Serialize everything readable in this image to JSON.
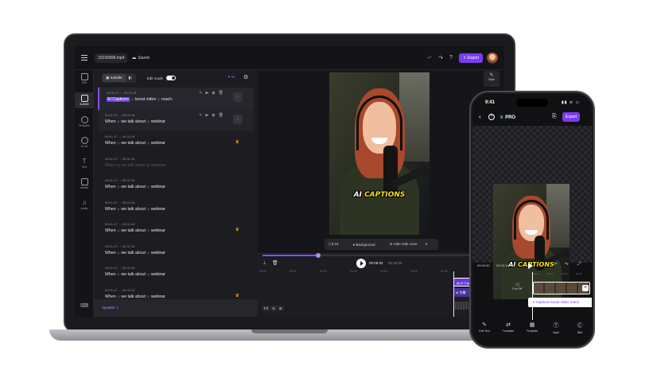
{
  "laptop": {
    "topbar": {
      "file_name": "20230908.mp4",
      "saved_label": "Saved",
      "undo_icon": "undo-icon",
      "redo_icon": "redo-icon",
      "help_icon": "help-icon",
      "export_label": "Export"
    },
    "left_rail": [
      {
        "label": "Edit",
        "icon": "edit-icon"
      },
      {
        "label": "Subtitle",
        "icon": "subtitle-icon",
        "active": true
      },
      {
        "label": "Template",
        "icon": "template-icon"
      },
      {
        "label": "B-roll",
        "icon": "broll-icon"
      },
      {
        "label": "Text",
        "icon": "text-icon"
      },
      {
        "label": "Media",
        "icon": "media-icon"
      },
      {
        "label": "Audio",
        "icon": "audio-icon"
      }
    ],
    "panel": {
      "tabs": [
        "Subtitle",
        ""
      ],
      "edit_mode_label": "Edit mode",
      "ai_label": "AI",
      "speaker_label": "Speaker 1"
    },
    "subtitles": [
      {
        "time": "00:01.47 → 00:02.18",
        "highlight": "AI Captions",
        "rest": "boost video",
        "tail": "reach."
      },
      {
        "time": "00:01.47 → 00:02.18",
        "highlight": "",
        "rest": "When",
        "mid": "we talk about",
        "tail": "webinar"
      },
      {
        "time": "00:01.47 → 00:02.18",
        "highlight": "",
        "rest": "When",
        "mid": "we talk about",
        "tail": "webinar"
      },
      {
        "time": "00:01.47 → 00:02.18",
        "highlight": "",
        "rest": "When",
        "mid": "we talk about",
        "tail": "webinar"
      },
      {
        "time": "00:01.47 → 00:02.18",
        "highlight": "",
        "rest": "When",
        "mid": "we talk about",
        "tail": "webinar"
      },
      {
        "time": "00:01.47 → 00:02.18",
        "highlight": "",
        "rest": "When",
        "mid": "we talk about",
        "tail": "webinar"
      },
      {
        "time": "00:01.47 → 00:02.18",
        "highlight": "",
        "rest": "When",
        "mid": "we talk about",
        "tail": "webinar"
      },
      {
        "time": "00:01.47 → 00:02.18",
        "highlight": "",
        "rest": "When",
        "mid": "we talk about",
        "tail": "webinar"
      },
      {
        "time": "00:01.47 → 00:02.18",
        "highlight": "",
        "rest": "When",
        "mid": "we talk about",
        "tail": "webinar"
      },
      {
        "time": "00:01.47 → 00:02.18",
        "highlight": "",
        "rest": "When",
        "mid": "we talk about",
        "tail": "webinar"
      }
    ],
    "preview": {
      "style_label": "Style",
      "caption_part1": "AI",
      "caption_part2": "CAPTIONS",
      "ratio": "9:16",
      "background_label": "Background",
      "safe_zone_label": "Hide safe zone"
    },
    "timeline": {
      "progress": 0.26,
      "current_time": "00:08.02",
      "total_time": "02:34.02",
      "ruler": [
        "00:00",
        "00:01",
        "00:02",
        "00:03",
        "00:04",
        "00:05",
        "00:06",
        "00:07"
      ],
      "clips_row1": [
        "AI Capti...",
        "boost",
        "video"
      ],
      "clips_row2": [
        "字幕",
        "提升",
        "视频"
      ],
      "fit_label": "Fit"
    }
  },
  "phone": {
    "time": "9:41",
    "pro_label": "PRO",
    "export_label": "Export",
    "caption_part1": "AI",
    "caption_part2": "CAPTIONS",
    "current_time": "00:00:00",
    "total_time": "00:00:10",
    "ruler": [
      "00:00",
      "00:01",
      "00:02",
      "00:03"
    ],
    "turn_off_label": "Turn Off",
    "caption_clip": "AI Captions boost video reach.",
    "tabs": [
      {
        "label": "Edit Text",
        "icon": "edit-text-icon"
      },
      {
        "label": "Translate",
        "icon": "translate-icon"
      },
      {
        "label": "Template",
        "icon": "template-icon"
      },
      {
        "label": "Style",
        "icon": "style-icon"
      },
      {
        "label": "Bilin",
        "icon": "bilingual-icon"
      }
    ]
  }
}
